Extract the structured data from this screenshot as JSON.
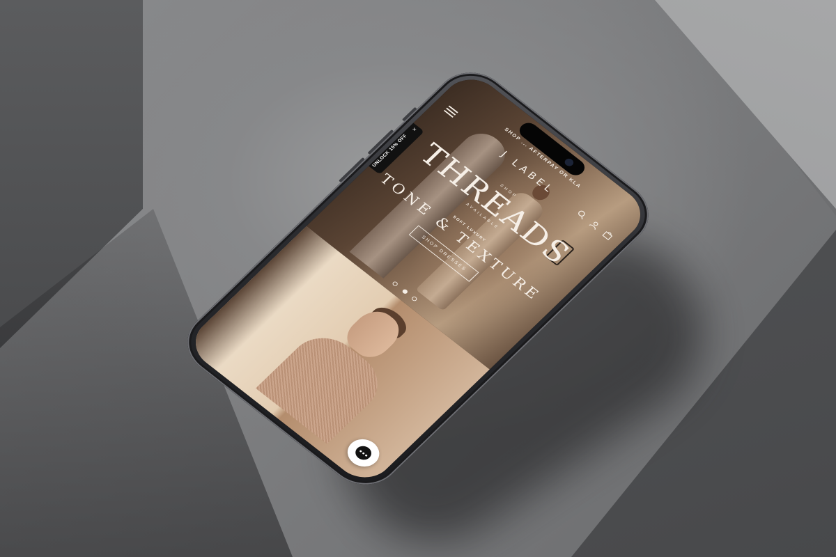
{
  "announcement": {
    "text": "SHOP ... AFTERPAY OR KLA"
  },
  "header": {
    "logo": "J LABEL",
    "icons": [
      "menu-icon",
      "search-icon",
      "account-icon",
      "cart-icon"
    ]
  },
  "hero": {
    "kicker": "SHOP",
    "title": "THREADS",
    "subtitle": "AVAILABLE",
    "tag": "SOFT LUXURY",
    "headline": "TONE & TEXTURE",
    "cta": "SHOP DRESSES"
  },
  "promo": {
    "label": "UNLOCK 15% OFF",
    "close": "×"
  },
  "carousel": {
    "total": 3,
    "active": 1
  },
  "colors": {
    "text_light": "#f4ede5",
    "accent_dark": "#111111"
  }
}
